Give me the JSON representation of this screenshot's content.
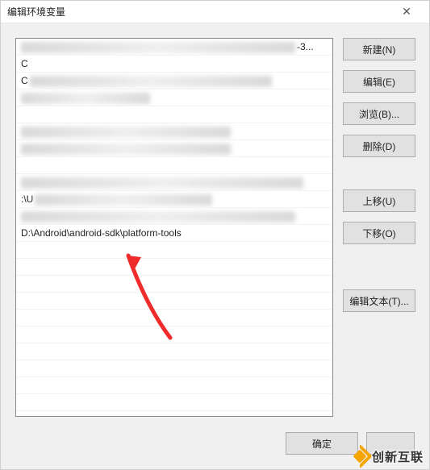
{
  "title": "编辑环境变量",
  "list": {
    "items": [
      {
        "visible": "",
        "redacted_width": 340,
        "trailing": "-3..."
      },
      {
        "visible": "C",
        "redacted_width": 0,
        "trailing": ""
      },
      {
        "visible": "C",
        "redacted_width": 300,
        "trailing": ""
      },
      {
        "visible": "",
        "redacted_width": 160,
        "trailing": ""
      },
      {
        "visible": "",
        "redacted_width": 0,
        "trailing": ""
      },
      {
        "visible": "",
        "redacted_width": 260,
        "trailing": ""
      },
      {
        "visible": "",
        "redacted_width": 260,
        "trailing": ""
      },
      {
        "visible": "",
        "redacted_width": 0,
        "trailing": ""
      },
      {
        "visible": "",
        "redacted_width": 350,
        "trailing": ""
      },
      {
        "visible": ":\\U",
        "redacted_width": 220,
        "trailing": ""
      },
      {
        "visible": "",
        "redacted_width": 340,
        "trailing": ""
      },
      {
        "visible": "D:\\Android\\android-sdk\\platform-tools",
        "redacted_width": 0,
        "trailing": ""
      }
    ]
  },
  "buttons": {
    "new": "新建(N)",
    "edit": "编辑(E)",
    "browse": "浏览(B)...",
    "delete": "删除(D)",
    "moveUp": "上移(U)",
    "moveDown": "下移(O)",
    "editText": "编辑文本(T)...",
    "ok": "确定",
    "cancel": ""
  },
  "watermark": "创新互联"
}
